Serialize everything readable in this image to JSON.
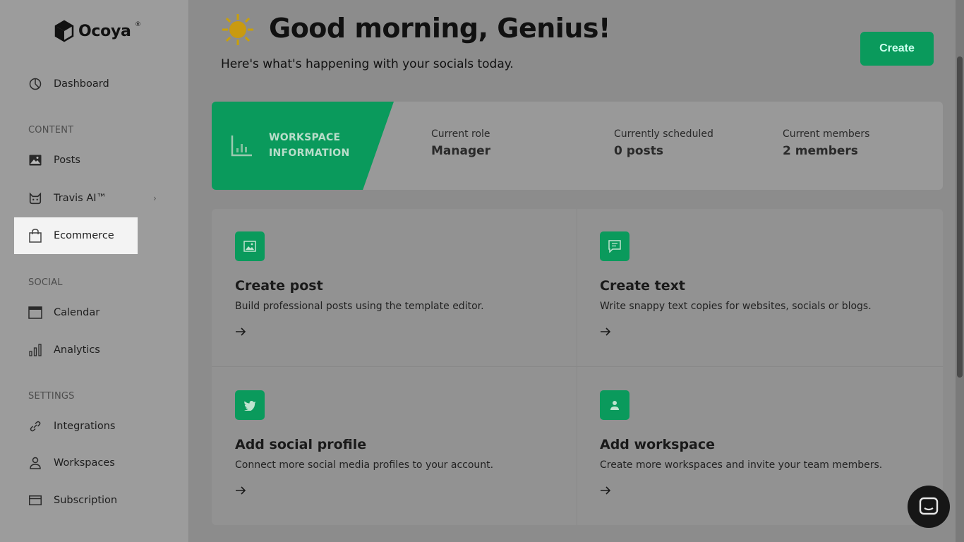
{
  "brand": {
    "name": "Ocoya",
    "reg": "®"
  },
  "sidebar": {
    "dashboard": "Dashboard",
    "sections": {
      "content": "CONTENT",
      "social": "SOCIAL",
      "settings": "SETTINGS"
    },
    "items": {
      "posts": "Posts",
      "travis": "Travis AI™",
      "ecommerce": "Ecommerce",
      "calendar": "Calendar",
      "analytics": "Analytics",
      "integrations": "Integrations",
      "workspaces": "Workspaces",
      "subscription": "Subscription"
    }
  },
  "header": {
    "greeting": "Good morning, Genius!",
    "subtitle": "Here's what's happening with your socials today.",
    "create_label": "Create"
  },
  "workspace": {
    "label_line1": "WORKSPACE",
    "label_line2": "INFORMATION",
    "stats": [
      {
        "label": "Current role",
        "value": "Manager"
      },
      {
        "label": "Currently scheduled",
        "value": "0 posts"
      },
      {
        "label": "Current members",
        "value": "2 members"
      }
    ]
  },
  "tiles": [
    {
      "title": "Create post",
      "desc": "Build professional posts using the template editor.",
      "icon": "image-icon"
    },
    {
      "title": "Create text",
      "desc": "Write snappy text copies for websites, socials or blogs.",
      "icon": "message-icon"
    },
    {
      "title": "Add social profile",
      "desc": "Connect more social media profiles to your account.",
      "icon": "twitter-icon"
    },
    {
      "title": "Add workspace",
      "desc": "Create more workspaces and invite your team members.",
      "icon": "user-icon"
    }
  ],
  "colors": {
    "brand_green": "#0a9a5c",
    "active_item_bg": "#f3f3f3"
  }
}
